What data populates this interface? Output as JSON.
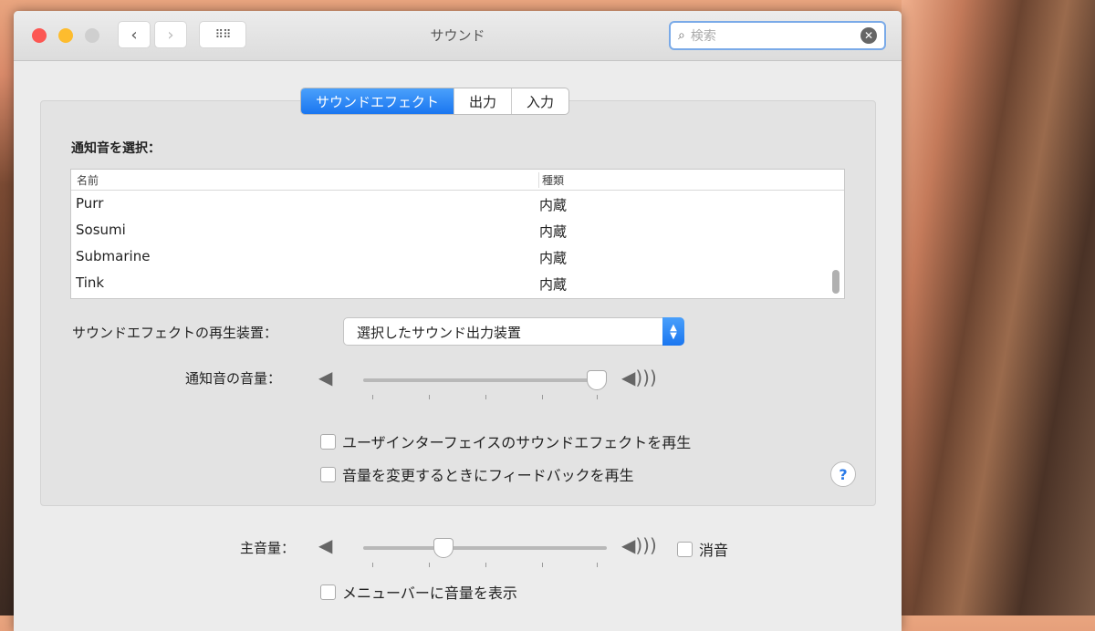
{
  "window": {
    "title": "サウンド",
    "search_placeholder": "検索"
  },
  "tabs": [
    {
      "label": "サウンドエフェクト",
      "active": true
    },
    {
      "label": "出力"
    },
    {
      "label": "入力"
    }
  ],
  "effects": {
    "alert_label": "通知音を選択：",
    "columns": [
      "名前",
      "種類"
    ],
    "rows": [
      [
        "Purr",
        "内蔵"
      ],
      [
        "Sosumi",
        "内蔵"
      ],
      [
        "Submarine",
        "内蔵"
      ],
      [
        "Tink",
        "内蔵"
      ]
    ],
    "device_label": "サウンドエフェクトの再生装置：",
    "device_value": "選択したサウンド出力装置",
    "alert_volume_label": "通知音の音量：",
    "alert_volume": 0.96,
    "ui_sound_label": "ユーザインターフェイスのサウンドエフェクトを再生",
    "feedback_label": "音量を変更するときにフィードバックを再生",
    "help": "?"
  },
  "master": {
    "label": "主音量：",
    "volume": 0.33,
    "mute_label": "消音",
    "menubar_label": "メニューバーに音量を表示"
  }
}
